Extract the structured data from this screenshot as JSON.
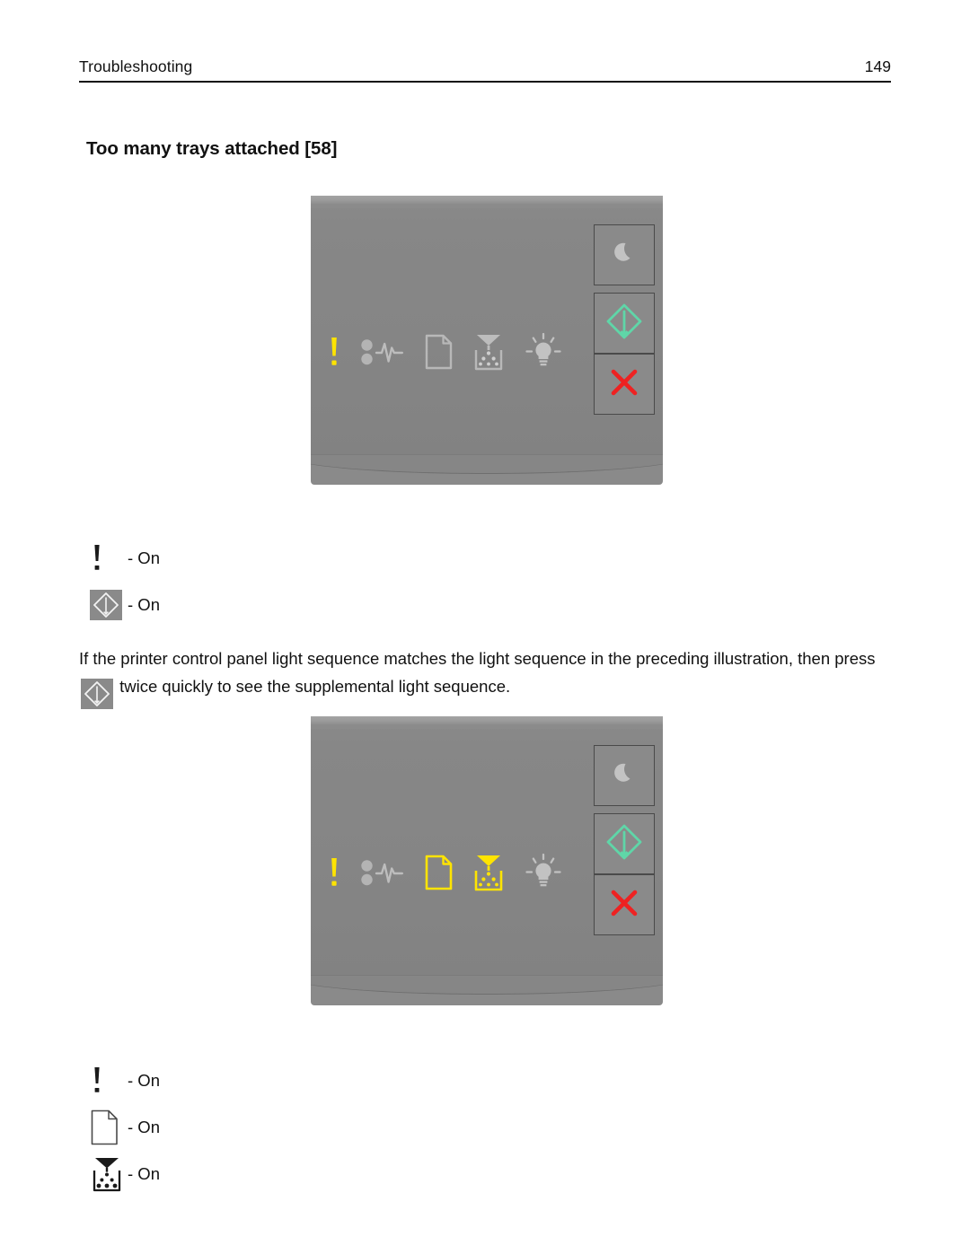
{
  "header": {
    "breadcrumb": "Troubleshooting",
    "page_number": "149"
  },
  "section": {
    "title": "Too many trays attached [58]"
  },
  "colors": {
    "panel_body": "#878787",
    "panel_bezel": "#a4a4a4",
    "indicator_off": "#b4b4b4",
    "indicator_on_amber": "#ffe400",
    "start_green": "#5fd6a8",
    "cancel_red": "#ee2222",
    "button_border": "#4a4a4a",
    "text": "#111111"
  },
  "illustrations": [
    {
      "name": "primary-light-sequence",
      "indicators": [
        {
          "icon": "error-exclamation-icon",
          "label": "Error",
          "state": "on",
          "color": "#ffe400"
        },
        {
          "icon": "paper-jam-icon",
          "label": "Paper Jam",
          "state": "off",
          "color": "#b4b4b4"
        },
        {
          "icon": "load-paper-icon",
          "label": "Load Paper",
          "state": "off",
          "color": "#b4b4b4"
        },
        {
          "icon": "toner-low-icon",
          "label": "Toner Low",
          "state": "off",
          "color": "#b4b4b4"
        },
        {
          "icon": "ready-lightbulb-icon",
          "label": "Ready",
          "state": "off",
          "color": "#b4b4b4"
        }
      ],
      "buttons": [
        {
          "icon": "sleep-moon-icon",
          "label": "Sleep",
          "color": "#c3c3c3"
        },
        {
          "icon": "start-diamond-icon",
          "label": "Start",
          "color": "#5fd6a8"
        },
        {
          "icon": "cancel-x-icon",
          "label": "Cancel",
          "color": "#ee2222"
        }
      ]
    },
    {
      "name": "supplemental-light-sequence",
      "indicators": [
        {
          "icon": "error-exclamation-icon",
          "label": "Error",
          "state": "on",
          "color": "#ffe400"
        },
        {
          "icon": "paper-jam-icon",
          "label": "Paper Jam",
          "state": "off",
          "color": "#b4b4b4"
        },
        {
          "icon": "load-paper-icon",
          "label": "Load Paper",
          "state": "on",
          "color": "#ffe400"
        },
        {
          "icon": "toner-low-icon",
          "label": "Toner Low",
          "state": "on",
          "color": "#ffe400"
        },
        {
          "icon": "ready-lightbulb-icon",
          "label": "Ready",
          "state": "off",
          "color": "#b4b4b4"
        }
      ],
      "buttons": [
        {
          "icon": "sleep-moon-icon",
          "label": "Sleep",
          "color": "#c3c3c3"
        },
        {
          "icon": "start-diamond-icon",
          "label": "Start",
          "color": "#5fd6a8"
        },
        {
          "icon": "cancel-x-icon",
          "label": "Cancel",
          "color": "#ee2222"
        }
      ]
    }
  ],
  "legend_primary": {
    "rows": [
      {
        "icon": "error-exclamation-icon",
        "state_text": "- On"
      },
      {
        "icon": "start-key-icon",
        "state_text": "- On"
      }
    ]
  },
  "legend_supplemental": {
    "rows": [
      {
        "icon": "error-exclamation-icon",
        "state_text": "- On"
      },
      {
        "icon": "load-paper-icon",
        "state_text": "- On"
      },
      {
        "icon": "toner-low-icon",
        "state_text": "- On"
      }
    ]
  },
  "paragraph": {
    "before_key": "If the printer control panel light sequence matches the light sequence in the preceding illustration, then press",
    "after_key": "twice quickly to see the supplemental light sequence."
  }
}
